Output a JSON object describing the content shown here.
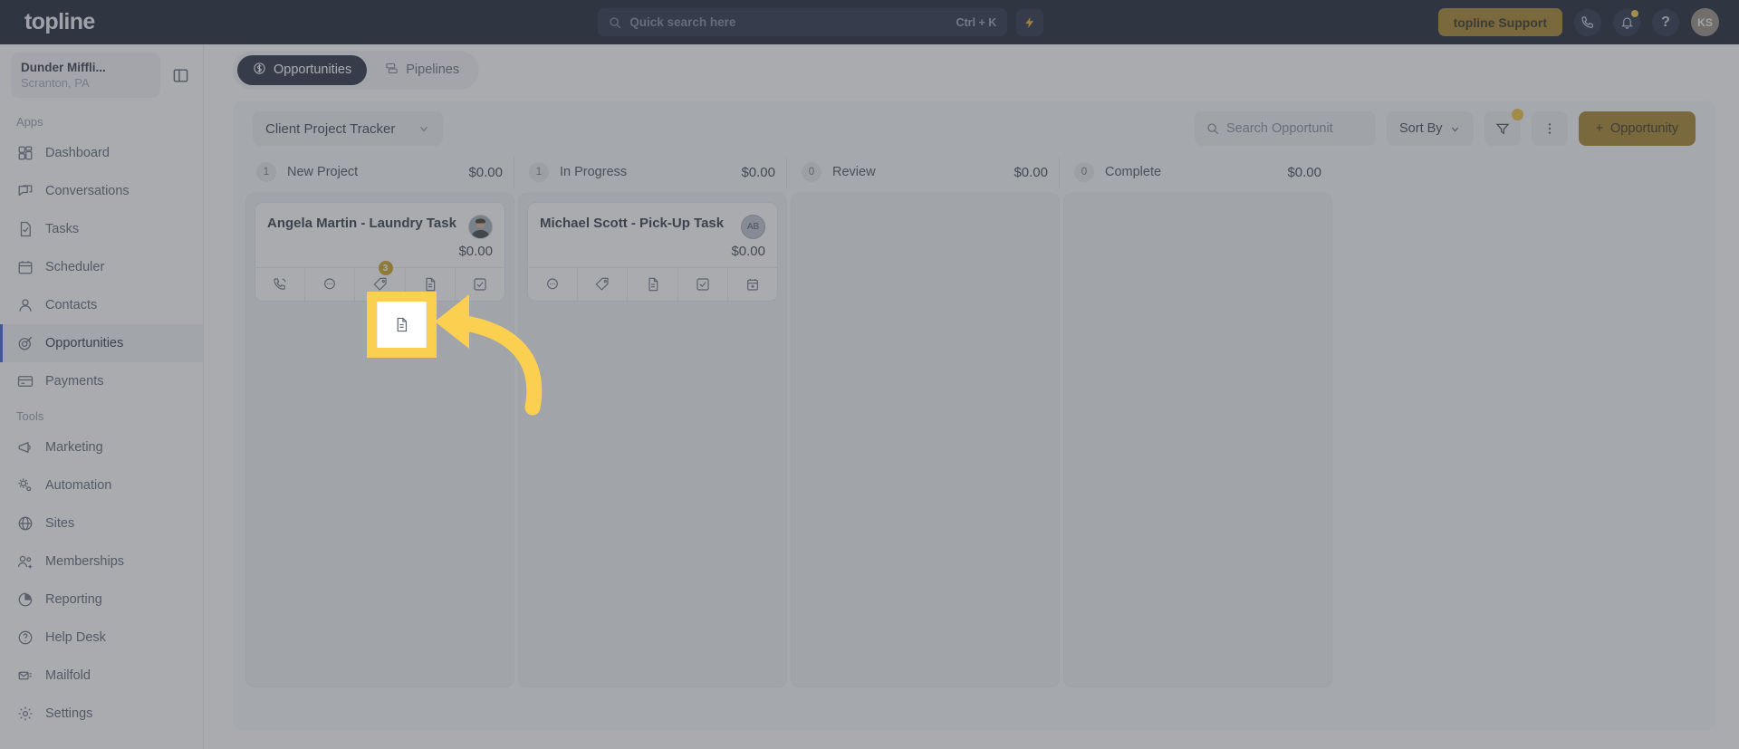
{
  "topbar": {
    "logo": "topline",
    "search": {
      "placeholder": "Quick search here",
      "shortcut": "Ctrl + K"
    },
    "bolt_icon": "lightning-bolt-icon",
    "support_label": "topline Support",
    "phone_icon": "phone-icon",
    "bell_icon": "bell-icon",
    "help_label": "?",
    "avatar_initials": "KS"
  },
  "sidebar": {
    "location": {
      "name": "Dunder Miffli...",
      "sub": "Scranton, PA"
    },
    "collapse_icon": "sidebar-panel-icon",
    "sections": [
      {
        "label": "Apps",
        "items": [
          {
            "label": "Dashboard",
            "icon": "dashboard-icon",
            "active": false
          },
          {
            "label": "Conversations",
            "icon": "chat-icon",
            "active": false
          },
          {
            "label": "Tasks",
            "icon": "task-check-icon",
            "active": false
          },
          {
            "label": "Scheduler",
            "icon": "calendar-icon",
            "active": false
          },
          {
            "label": "Contacts",
            "icon": "user-icon",
            "active": false
          },
          {
            "label": "Opportunities",
            "icon": "target-icon",
            "active": true
          },
          {
            "label": "Payments",
            "icon": "credit-card-icon",
            "active": false
          }
        ]
      },
      {
        "label": "Tools",
        "items": [
          {
            "label": "Marketing",
            "icon": "megaphone-icon",
            "active": false
          },
          {
            "label": "Automation",
            "icon": "gears-icon",
            "active": false
          },
          {
            "label": "Sites",
            "icon": "globe-icon",
            "active": false
          },
          {
            "label": "Memberships",
            "icon": "users-plus-icon",
            "active": false
          },
          {
            "label": "Reporting",
            "icon": "pie-chart-icon",
            "active": false
          },
          {
            "label": "Help Desk",
            "icon": "question-circle-icon",
            "active": false
          },
          {
            "label": "Mailfold",
            "icon": "mail-stack-icon",
            "active": false
          },
          {
            "label": "Settings",
            "icon": "gear-icon",
            "active": false
          }
        ]
      }
    ]
  },
  "tabs": [
    {
      "label": "Opportunities",
      "icon": "dollar-circle-icon",
      "active": true
    },
    {
      "label": "Pipelines",
      "icon": "pipeline-icon",
      "active": false
    }
  ],
  "toolbar": {
    "pipeline_label": "Client Project Tracker",
    "chevron_icon": "chevron-down-icon",
    "search_placeholder": "Search Opportunit",
    "search_icon": "search-icon",
    "sort_label": "Sort By",
    "filter_icon": "filter-icon",
    "more_icon": "more-vertical-icon",
    "add_label": "Opportunity",
    "add_prefix": "+"
  },
  "board": {
    "columns": [
      {
        "count": "1",
        "name": "New Project",
        "sum": "$0.00",
        "cards": [
          {
            "title": "Angela Martin - Laundry Task",
            "amount": "$0.00",
            "avatar_type": "photo",
            "avatar_initials": "",
            "actions": [
              {
                "icon": "phone-call-icon",
                "badge": ""
              },
              {
                "icon": "message-icon",
                "badge": ""
              },
              {
                "icon": "tag-icon",
                "badge": "3"
              },
              {
                "icon": "document-icon",
                "badge": ""
              },
              {
                "icon": "checkbox-icon",
                "badge": ""
              }
            ]
          }
        ]
      },
      {
        "count": "1",
        "name": "In Progress",
        "sum": "$0.00",
        "cards": [
          {
            "title": "Michael Scott - Pick-Up Task",
            "amount": "$0.00",
            "avatar_type": "initials",
            "avatar_initials": "AB",
            "actions": [
              {
                "icon": "message-icon",
                "badge": ""
              },
              {
                "icon": "tag-icon",
                "badge": ""
              },
              {
                "icon": "document-icon",
                "badge": ""
              },
              {
                "icon": "checkbox-icon",
                "badge": ""
              },
              {
                "icon": "calendar-plus-icon",
                "badge": ""
              }
            ]
          }
        ]
      },
      {
        "count": "0",
        "name": "Review",
        "sum": "$0.00",
        "cards": []
      },
      {
        "count": "0",
        "name": "Complete",
        "sum": "$0.00",
        "cards": []
      }
    ]
  },
  "annotation": {
    "highlight_target": "document-icon",
    "arrow_color": "#fbd051",
    "highlight_color": "#fbd051"
  },
  "colors": {
    "brand_gold": "#9c7614",
    "accent_yellow": "#f0bb2a",
    "topbar_dark": "#030a1f",
    "active_nav": "#2b50d4"
  }
}
